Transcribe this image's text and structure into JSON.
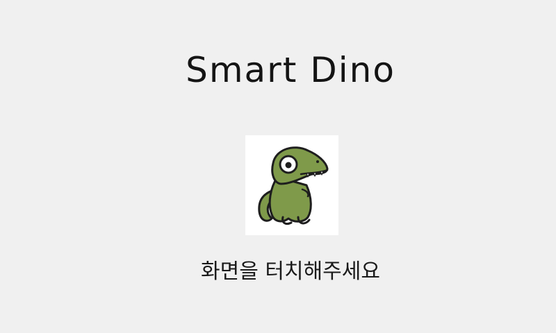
{
  "app": {
    "title": "Smart Dino",
    "prompt": "화면을 터치해주세요",
    "logo_icon": "dino-mascot-icon"
  },
  "colors": {
    "background": "#f0f0f0",
    "text": "#141414",
    "dino_body": "#7f9a4a",
    "dino_outline": "#1e1e1e"
  }
}
